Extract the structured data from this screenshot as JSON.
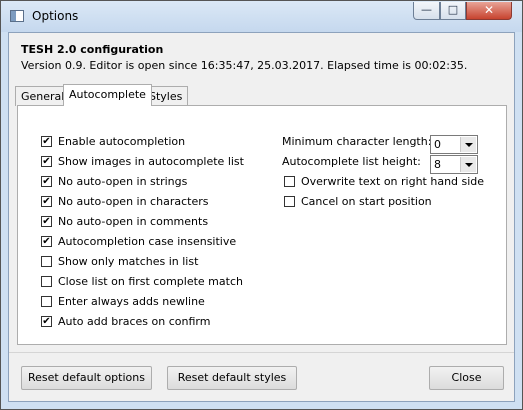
{
  "window": {
    "title": "Options",
    "minimize_icon": "minimize-icon",
    "maximize_icon": "maximize-icon",
    "close_icon": "close-icon"
  },
  "header": {
    "title": "TESH 2.0 configuration",
    "subtitle": "Version 0.9. Editor is open since 16:35:47, 25.03.2017. Elapsed time is 00:02:35."
  },
  "tabs": [
    {
      "label": "General",
      "active": false
    },
    {
      "label": "Autocomplete",
      "active": true
    },
    {
      "label": "Styles",
      "active": false
    }
  ],
  "autocomplete": {
    "left_options": [
      {
        "label": "Enable autocompletion",
        "checked": true
      },
      {
        "label": "Show images in autocomplete list",
        "checked": true
      },
      {
        "label": "No auto-open in strings",
        "checked": true
      },
      {
        "label": "No auto-open in characters",
        "checked": true
      },
      {
        "label": "No auto-open in comments",
        "checked": true
      },
      {
        "label": "Autocompletion case insensitive",
        "checked": true
      },
      {
        "label": "Show only matches in list",
        "checked": false
      },
      {
        "label": "Close list on first complete match",
        "checked": false
      },
      {
        "label": "Enter always adds newline",
        "checked": false
      },
      {
        "label": "Auto add braces on confirm",
        "checked": true
      }
    ],
    "min_char_length": {
      "label": "Minimum character length:",
      "value": "0"
    },
    "list_height": {
      "label": "Autocomplete list height:",
      "value": "8"
    },
    "right_options": [
      {
        "label": "Overwrite text on right hand side",
        "checked": false
      },
      {
        "label": "Cancel on start position",
        "checked": false
      }
    ]
  },
  "buttons": {
    "reset_options": "Reset default options",
    "reset_styles": "Reset default styles",
    "close": "Close"
  }
}
